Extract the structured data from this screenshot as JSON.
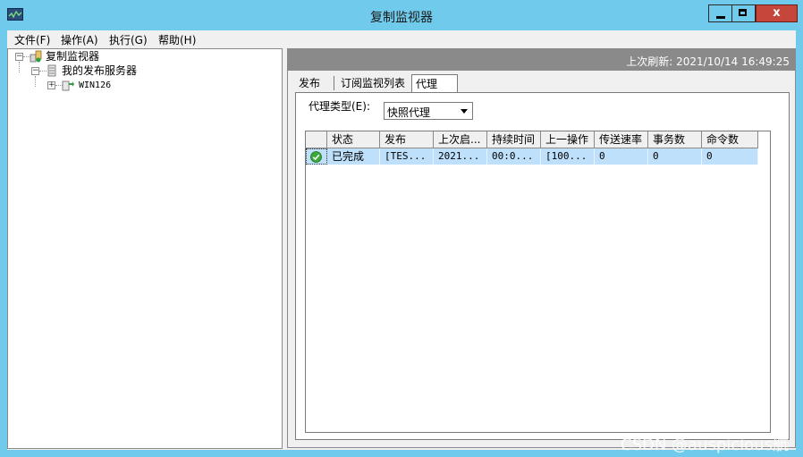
{
  "window": {
    "title": "复制监视器",
    "close_glyph": "x"
  },
  "menubar": {
    "items": [
      "文件(F)",
      "操作(A)",
      "执行(G)",
      "帮助(H)"
    ]
  },
  "tree": {
    "root": "复制监视器",
    "publishers": "我的发布服务器",
    "server": "WIN126"
  },
  "right": {
    "refresh": "上次刷新: 2021/10/14 16:49:25",
    "tabs": [
      "发布",
      "订阅监视列表",
      "代理"
    ],
    "active_tab": "代理",
    "agent_type_label": "代理类型(E):",
    "agent_type_value": "快照代理"
  },
  "grid": {
    "columns": [
      "状态",
      "发布",
      "上次启...",
      "持续时间",
      "上一操作",
      "传送速率",
      "事务数",
      "命令数"
    ],
    "rows": [
      {
        "status_icon": "success-check-icon",
        "cells": [
          "已完成",
          "[TES...",
          "2021...",
          "00:0...",
          "[100...",
          "0",
          "0",
          "0"
        ]
      }
    ]
  },
  "watermark": "CSDN @auspicious航",
  "colors": {
    "titlebar": "#6fcaec",
    "close_button": "#c7463b",
    "selected_row": "#bfe0fb",
    "refresh_bar": "#8a8a8a"
  }
}
